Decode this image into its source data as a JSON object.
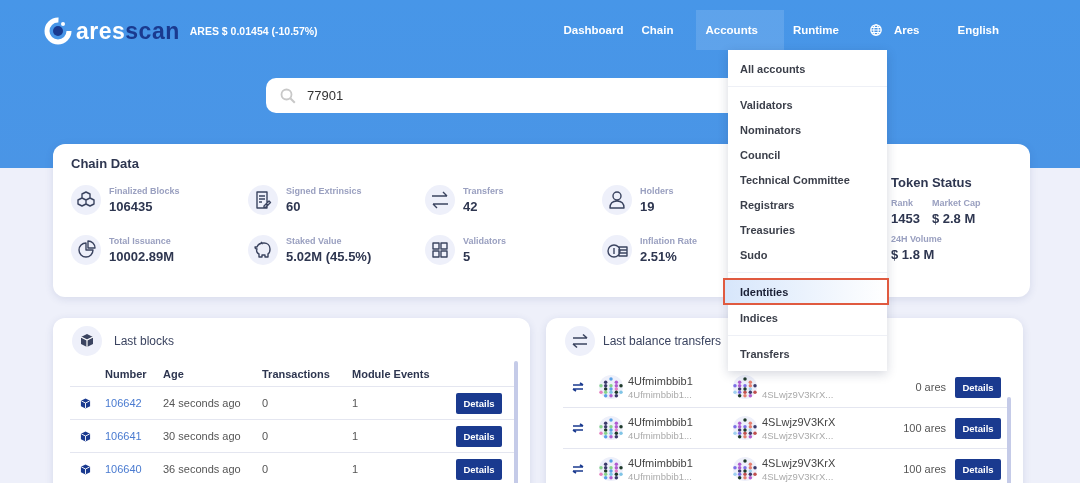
{
  "header": {
    "logo_prefix": "ares",
    "logo_suffix": "scan",
    "price": "ARES $ 0.01454 (-10.57%)",
    "nav": [
      {
        "label": "Dashboard",
        "kind": "link",
        "selected": false
      },
      {
        "label": "Chain",
        "kind": "link",
        "selected": false
      },
      {
        "label": "Accounts",
        "kind": "link",
        "selected": true
      },
      {
        "label": "Runtime",
        "kind": "link",
        "selected": false
      },
      {
        "label": "Ares",
        "kind": "network",
        "selected": false
      },
      {
        "label": "English",
        "kind": "link",
        "selected": false
      }
    ]
  },
  "search": {
    "value": "77901"
  },
  "accounts_menu": {
    "groups": [
      [
        {
          "label": "All accounts",
          "selected": false
        }
      ],
      [
        {
          "label": "Validators",
          "selected": false
        },
        {
          "label": "Nominators",
          "selected": false
        },
        {
          "label": "Council",
          "selected": false
        },
        {
          "label": "Technical Committee",
          "selected": false
        },
        {
          "label": "Registrars",
          "selected": false
        },
        {
          "label": "Treasuries",
          "selected": false
        },
        {
          "label": "Sudo",
          "selected": false
        }
      ],
      [
        {
          "label": "Identities",
          "selected": true
        },
        {
          "label": "Indices",
          "selected": false
        }
      ],
      [
        {
          "label": "Transfers",
          "selected": false
        }
      ]
    ]
  },
  "chain_data": {
    "title": "Chain Data",
    "stats": [
      {
        "kind": "blocks",
        "label": "Finalized Blocks",
        "value": "106435"
      },
      {
        "kind": "extrinsics",
        "label": "Signed Extrinsics",
        "value": "60"
      },
      {
        "kind": "transfers",
        "label": "Transfers",
        "value": "42"
      },
      {
        "kind": "holders",
        "label": "Holders",
        "value": "19"
      },
      {
        "kind": "issuance",
        "label": "Total Issuance",
        "value": "10002.89M"
      },
      {
        "kind": "staked",
        "label": "Staked Value",
        "value": "5.02M (45.5%)"
      },
      {
        "kind": "validators",
        "label": "Validators",
        "value": "5"
      },
      {
        "kind": "inflation",
        "label": "Inflation Rate",
        "value": "2.51%"
      }
    ]
  },
  "token_status": {
    "title": "Token Status",
    "rank_label": "Rank",
    "rank": "1453",
    "market_cap_label": "Market Cap",
    "market_cap": "$ 2.8 M",
    "volume_label": "24H Volume",
    "volume": "$ 1.8 M"
  },
  "last_blocks": {
    "title": "Last blocks",
    "columns": [
      "Number",
      "Age",
      "Transactions",
      "Module Events"
    ],
    "rows": [
      {
        "number": "106642",
        "age": "24 seconds ago",
        "transactions": "0",
        "module_events": "1",
        "action": "Details"
      },
      {
        "number": "106641",
        "age": "30 seconds ago",
        "transactions": "0",
        "module_events": "1",
        "action": "Details"
      },
      {
        "number": "106640",
        "age": "36 seconds ago",
        "transactions": "0",
        "module_events": "1",
        "action": "Details"
      }
    ]
  },
  "last_transfers": {
    "title": "Last balance transfers",
    "rows": [
      {
        "from_name": "4Ufmimbbib1",
        "from_address": "4Ufmimbbib1...",
        "to_address": "4SLwjz9V3KrX...",
        "amount": "0 ares",
        "action": "Details"
      },
      {
        "from_name": "4Ufmimbbib1",
        "from_address": "4Ufmimbbib1...",
        "to_name": "4SLwjz9V3KrX",
        "to_address": "4SLwjz9V3KrX...",
        "amount": "100 ares",
        "action": "Details"
      },
      {
        "from_name": "4Ufmimbbib1",
        "from_address": "4Ufmimbbib1...",
        "to_name": "4SLwjz9V3KrX",
        "to_address": "4SLwjz9V3KrX...",
        "amount": "100 ares",
        "action": "Details"
      }
    ]
  }
}
